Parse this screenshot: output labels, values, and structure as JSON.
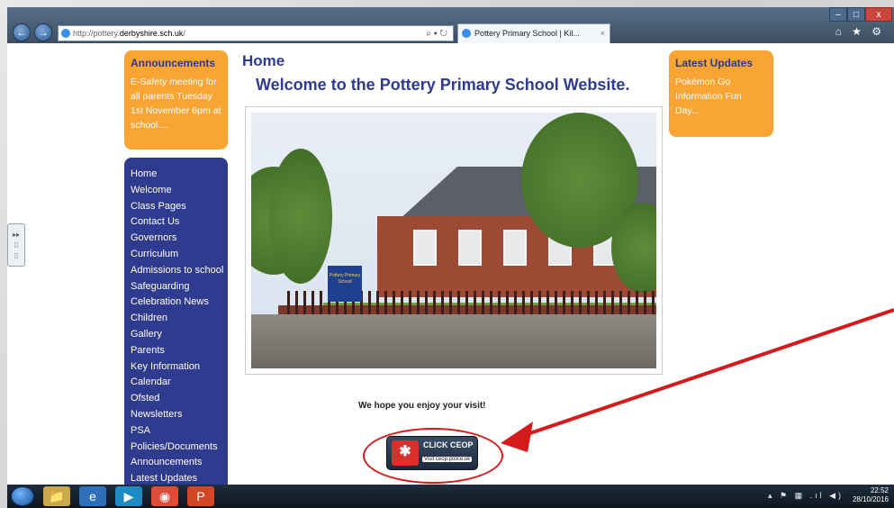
{
  "browser": {
    "url_prefix": "http://pottery.",
    "url_domain": "derbyshire.sch.uk",
    "url_suffix": "/",
    "address_controls": "⌕ ▾ ↻",
    "tab_title": "Pottery Primary School | Kil...",
    "tab_close": "×",
    "back_icon": "back-arrow-icon",
    "forward_icon": "forward-arrow-icon",
    "right_icons": "⌂ ★ ⚙"
  },
  "window": {
    "minimize": "–",
    "maximize": "□",
    "close": "x"
  },
  "side_handle": {
    "glyph": "▸▸\n⁞⁞"
  },
  "announcements": {
    "title": "Announcements",
    "text": "E-Safety meeting for all parents Tuesday 1st November 6pm at school...."
  },
  "menu": {
    "items": [
      "Home",
      "Welcome",
      "Class Pages",
      "Contact Us",
      "Governors",
      "Curriculum",
      "Admissions to school",
      "Safeguarding",
      "Celebration News",
      "Children",
      "Gallery",
      "Parents",
      "Key Information",
      "Calendar",
      "Ofsted",
      "Newsletters",
      "PSA",
      "Policies/Documents",
      "Announcements",
      "Latest Updates"
    ]
  },
  "main": {
    "heading": "Home",
    "welcome": "Welcome to the Pottery Primary School Website.",
    "sign_text": "Pottery Primary School",
    "hope_text": "We hope you enjoy your visit!"
  },
  "ceop": {
    "title": "CLICK CEOP",
    "subtitle": "Visit ceop.police.uk",
    "icon_glyph": "✱"
  },
  "latest_updates": {
    "title": "Latest Updates",
    "text": "Pokémon Go Information Fun Day..."
  },
  "annotation": {
    "color": "#d41a1a"
  },
  "taskbar": {
    "items": [
      "📁",
      "e",
      "▶",
      "◉",
      "P"
    ],
    "tray_icons": "▴ ⚑ ▦ .ıl ◀)",
    "time": "22:52",
    "date": "28/10/2016"
  },
  "colors": {
    "orange": "#f9a534",
    "navy": "#2f3b8e"
  }
}
